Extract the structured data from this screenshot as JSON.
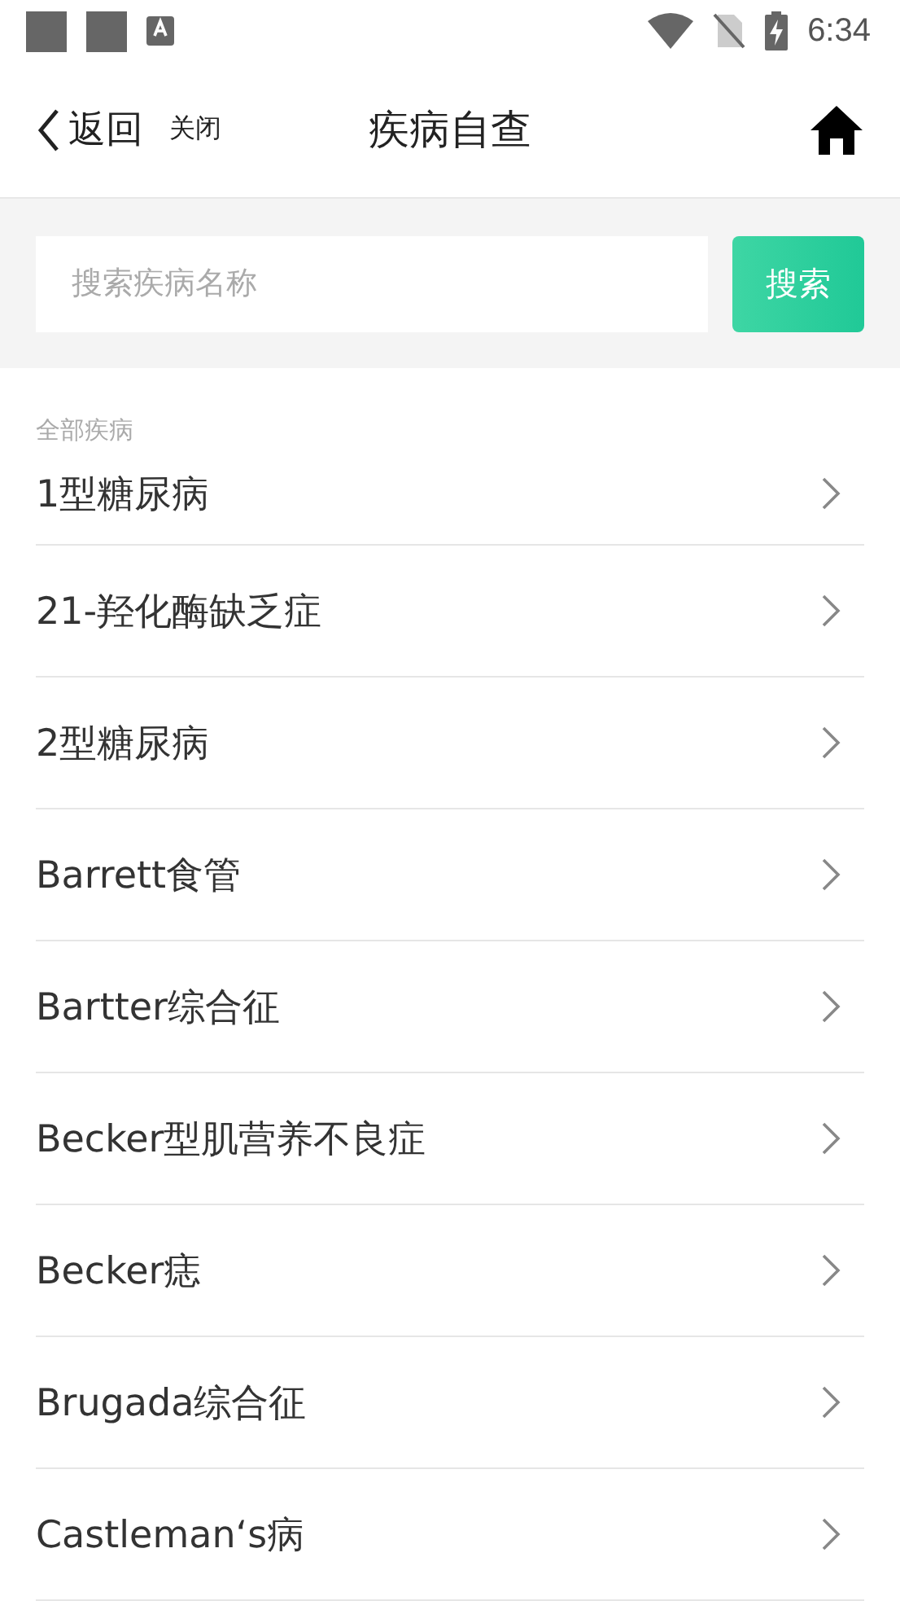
{
  "status_bar": {
    "time": "6:34"
  },
  "header": {
    "back": "返回",
    "close": "关闭",
    "title": "疾病自查"
  },
  "search": {
    "placeholder": "搜索疾病名称",
    "button": "搜索"
  },
  "section_label": "全部疾病",
  "diseases": [
    {
      "name": "1型糖尿病"
    },
    {
      "name": "21-羟化酶缺乏症"
    },
    {
      "name": "2型糖尿病"
    },
    {
      "name": "Barrett食管"
    },
    {
      "name": "Bartter综合征"
    },
    {
      "name": "Becker型肌营养不良症"
    },
    {
      "name": "Becker痣"
    },
    {
      "name": "Brugada综合征"
    },
    {
      "name": "Castleman‘s病"
    }
  ]
}
